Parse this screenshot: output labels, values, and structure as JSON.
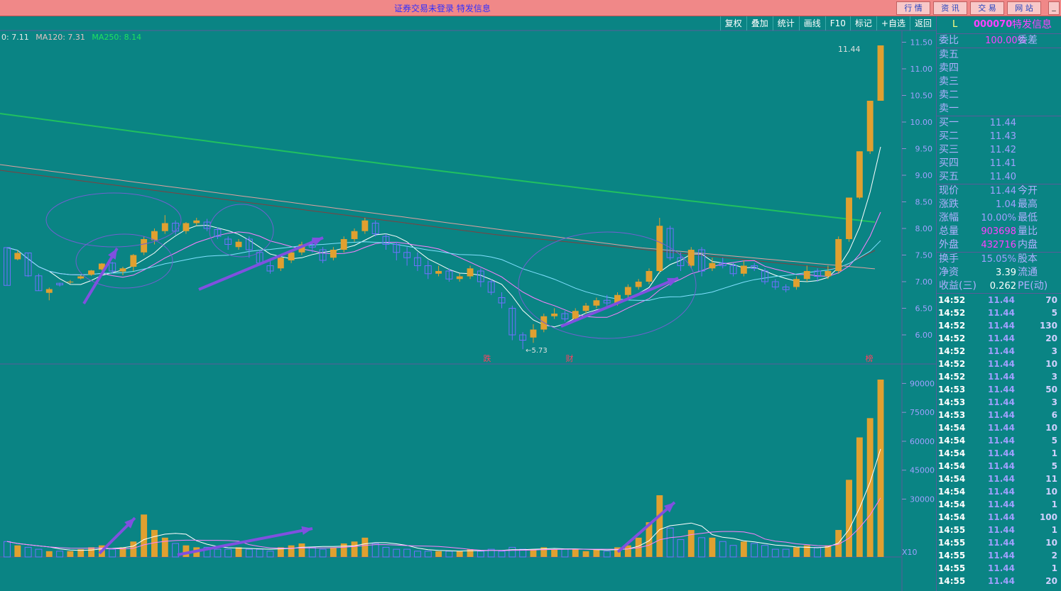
{
  "topbar": {
    "title": "证券交易未登录  特发信息",
    "buttons": [
      "行 情",
      "资 讯",
      "交 易",
      "网 站"
    ],
    "min_glyph": "_"
  },
  "toolbar": [
    "复权",
    "叠加",
    "统计",
    "画线",
    "F10",
    "标记",
    "+自选",
    "返回"
  ],
  "ma_legend": {
    "ma60": "0: 7.11",
    "ma120": "MA120: 7.31",
    "ma250": "MA250: 8.14"
  },
  "price_axis": [
    "11.50",
    "11.00",
    "10.50",
    "10.00",
    "9.50",
    "9.00",
    "8.50",
    "8.00",
    "7.50",
    "7.00",
    "6.50",
    "6.00"
  ],
  "volume_axis": [
    "90000",
    "75000",
    "60000",
    "45000",
    "30000"
  ],
  "volume_scale_label": "X10",
  "annotations": {
    "low": "5.73",
    "high": "11.44",
    "markers": [
      "跌",
      "财",
      "榜"
    ]
  },
  "panel": {
    "l": "L",
    "code": "000070",
    "name": "特发信息",
    "weibi_label": "委比",
    "weibi_value": "100.00%",
    "weicha_label": "委差",
    "sell": [
      {
        "label": "卖五",
        "price": ""
      },
      {
        "label": "卖四",
        "price": ""
      },
      {
        "label": "卖三",
        "price": ""
      },
      {
        "label": "卖二",
        "price": ""
      },
      {
        "label": "卖一",
        "price": ""
      }
    ],
    "buy": [
      {
        "label": "买一",
        "price": "11.44"
      },
      {
        "label": "买二",
        "price": "11.43"
      },
      {
        "label": "买三",
        "price": "11.42"
      },
      {
        "label": "买四",
        "price": "11.41"
      },
      {
        "label": "买五",
        "price": "11.40"
      }
    ],
    "stats1": [
      {
        "k": "现价",
        "v": "11.44",
        "k2": "今开"
      },
      {
        "k": "涨跌",
        "v": "1.04",
        "k2": "最高"
      },
      {
        "k": "涨幅",
        "v": "10.00%",
        "k2": "最低"
      },
      {
        "k": "总量",
        "v": "903698",
        "k2": "量比"
      },
      {
        "k": "外盘",
        "v": "432716",
        "k2": "内盘"
      }
    ],
    "stats2": [
      {
        "k": "换手",
        "v": "15.05%",
        "k2": "股本"
      },
      {
        "k": "净资",
        "v": "3.39",
        "k2": "流通"
      },
      {
        "k": "收益(三)",
        "v": "0.262",
        "k2": "PE(动)"
      }
    ],
    "ticks": [
      {
        "t": "14:52",
        "p": "11.44",
        "q": "70"
      },
      {
        "t": "14:52",
        "p": "11.44",
        "q": "5"
      },
      {
        "t": "14:52",
        "p": "11.44",
        "q": "130"
      },
      {
        "t": "14:52",
        "p": "11.44",
        "q": "20"
      },
      {
        "t": "14:52",
        "p": "11.44",
        "q": "3"
      },
      {
        "t": "14:52",
        "p": "11.44",
        "q": "10"
      },
      {
        "t": "14:52",
        "p": "11.44",
        "q": "3"
      },
      {
        "t": "14:53",
        "p": "11.44",
        "q": "50"
      },
      {
        "t": "14:53",
        "p": "11.44",
        "q": "3"
      },
      {
        "t": "14:53",
        "p": "11.44",
        "q": "6"
      },
      {
        "t": "14:54",
        "p": "11.44",
        "q": "10"
      },
      {
        "t": "14:54",
        "p": "11.44",
        "q": "5"
      },
      {
        "t": "14:54",
        "p": "11.44",
        "q": "1"
      },
      {
        "t": "14:54",
        "p": "11.44",
        "q": "5"
      },
      {
        "t": "14:54",
        "p": "11.44",
        "q": "11"
      },
      {
        "t": "14:54",
        "p": "11.44",
        "q": "10"
      },
      {
        "t": "14:54",
        "p": "11.44",
        "q": "1"
      },
      {
        "t": "14:54",
        "p": "11.44",
        "q": "100"
      },
      {
        "t": "14:55",
        "p": "11.44",
        "q": "1"
      },
      {
        "t": "14:55",
        "p": "11.44",
        "q": "10"
      },
      {
        "t": "14:55",
        "p": "11.44",
        "q": "2"
      },
      {
        "t": "14:55",
        "p": "11.44",
        "q": "1"
      },
      {
        "t": "14:55",
        "p": "11.44",
        "q": "20"
      }
    ]
  },
  "colors": {
    "bg": "#0a8484",
    "up": "#e0a030",
    "down": "#7070ff",
    "ma5": "#ffffff",
    "ma10": "#ff80ff",
    "ma20": "#80e0ff",
    "ma60": "#804040",
    "ma120": "#e0a0a0",
    "ma250": "#20c060",
    "arrow": "#8050e0"
  },
  "candles": [
    [
      6.93,
      7.64,
      7.65,
      6.93,
      "down"
    ],
    [
      7.42,
      7.54,
      7.59,
      7.4,
      "up"
    ],
    [
      7.54,
      7.11,
      7.54,
      7.09,
      "down"
    ],
    [
      7.11,
      6.83,
      7.15,
      6.83,
      "down"
    ],
    [
      6.79,
      6.86,
      6.89,
      6.65,
      "up"
    ],
    [
      6.97,
      6.94,
      6.98,
      6.91,
      "down"
    ],
    [
      6.99,
      7.0,
      7.03,
      6.96,
      "up"
    ],
    [
      7.06,
      7.1,
      7.12,
      7.04,
      "up"
    ],
    [
      7.13,
      7.21,
      7.22,
      7.11,
      "up"
    ],
    [
      7.23,
      7.34,
      7.35,
      7.21,
      "up"
    ],
    [
      7.35,
      7.2,
      7.37,
      7.15,
      "down"
    ],
    [
      7.19,
      7.25,
      7.28,
      7.12,
      "up"
    ],
    [
      7.28,
      7.5,
      7.52,
      7.2,
      "up"
    ],
    [
      7.55,
      7.8,
      7.85,
      7.5,
      "up"
    ],
    [
      7.78,
      7.95,
      8.0,
      7.7,
      "up"
    ],
    [
      7.95,
      8.1,
      8.25,
      7.9,
      "up"
    ],
    [
      8.1,
      7.95,
      8.15,
      7.88,
      "down"
    ],
    [
      7.95,
      8.1,
      8.12,
      7.9,
      "up"
    ],
    [
      8.1,
      8.15,
      8.2,
      8.05,
      "up"
    ],
    [
      8.12,
      8.0,
      8.18,
      7.95,
      "down"
    ],
    [
      7.98,
      7.85,
      8.02,
      7.8,
      "down"
    ],
    [
      7.8,
      7.7,
      7.85,
      7.6,
      "down"
    ],
    [
      7.65,
      7.75,
      7.8,
      7.6,
      "up"
    ],
    [
      7.8,
      7.6,
      7.85,
      7.45,
      "down"
    ],
    [
      7.55,
      7.35,
      7.6,
      7.3,
      "down"
    ],
    [
      7.3,
      7.2,
      7.4,
      7.15,
      "down"
    ],
    [
      7.25,
      7.45,
      7.5,
      7.2,
      "up"
    ],
    [
      7.4,
      7.55,
      7.6,
      7.35,
      "up"
    ],
    [
      7.55,
      7.7,
      7.75,
      7.5,
      "up"
    ],
    [
      7.7,
      7.65,
      7.8,
      7.55,
      "down"
    ],
    [
      7.6,
      7.4,
      7.65,
      7.35,
      "down"
    ],
    [
      7.45,
      7.6,
      7.65,
      7.4,
      "up"
    ],
    [
      7.6,
      7.8,
      7.85,
      7.55,
      "up"
    ],
    [
      7.8,
      7.95,
      8.0,
      7.75,
      "up"
    ],
    [
      7.95,
      8.15,
      8.2,
      7.9,
      "up"
    ],
    [
      8.1,
      7.9,
      8.15,
      7.85,
      "down"
    ],
    [
      7.85,
      7.7,
      7.9,
      7.6,
      "down"
    ],
    [
      7.7,
      7.55,
      7.75,
      7.4,
      "down"
    ],
    [
      7.55,
      7.45,
      7.65,
      7.3,
      "down"
    ],
    [
      7.45,
      7.3,
      7.55,
      7.2,
      "down"
    ],
    [
      7.3,
      7.15,
      7.4,
      7.05,
      "down"
    ],
    [
      7.15,
      7.2,
      7.3,
      7.1,
      "up"
    ],
    [
      7.2,
      7.05,
      7.25,
      7.0,
      "down"
    ],
    [
      7.05,
      7.1,
      7.15,
      7.0,
      "up"
    ],
    [
      7.1,
      7.25,
      7.3,
      7.05,
      "up"
    ],
    [
      7.2,
      7.0,
      7.25,
      6.9,
      "down"
    ],
    [
      7.0,
      6.8,
      7.05,
      6.75,
      "down"
    ],
    [
      6.7,
      6.6,
      6.8,
      6.5,
      "down"
    ],
    [
      6.5,
      6.0,
      6.55,
      5.9,
      "down"
    ],
    [
      6.0,
      5.9,
      6.05,
      5.73,
      "down"
    ],
    [
      5.95,
      6.1,
      6.2,
      5.85,
      "up"
    ],
    [
      6.1,
      6.35,
      6.4,
      6.05,
      "up"
    ],
    [
      6.35,
      6.4,
      6.5,
      6.3,
      "up"
    ],
    [
      6.4,
      6.3,
      6.45,
      6.25,
      "down"
    ],
    [
      6.3,
      6.45,
      6.5,
      6.25,
      "up"
    ],
    [
      6.45,
      6.55,
      6.6,
      6.4,
      "up"
    ],
    [
      6.55,
      6.65,
      6.7,
      6.5,
      "up"
    ],
    [
      6.65,
      6.6,
      6.75,
      6.55,
      "down"
    ],
    [
      6.6,
      6.75,
      6.8,
      6.55,
      "up"
    ],
    [
      6.75,
      6.9,
      6.95,
      6.7,
      "up"
    ],
    [
      6.9,
      7.0,
      7.05,
      6.85,
      "up"
    ],
    [
      7.0,
      7.2,
      7.25,
      6.95,
      "up"
    ],
    [
      7.2,
      8.05,
      8.2,
      7.15,
      "up"
    ],
    [
      8.0,
      7.45,
      8.05,
      7.4,
      "down"
    ],
    [
      7.45,
      7.3,
      7.55,
      7.2,
      "down"
    ],
    [
      7.3,
      7.6,
      7.65,
      7.25,
      "up"
    ],
    [
      7.6,
      7.2,
      7.65,
      7.1,
      "down"
    ],
    [
      7.25,
      7.35,
      7.45,
      7.2,
      "up"
    ],
    [
      7.35,
      7.3,
      7.45,
      7.25,
      "down"
    ],
    [
      7.3,
      7.15,
      7.35,
      7.1,
      "down"
    ],
    [
      7.15,
      7.3,
      7.4,
      7.1,
      "up"
    ],
    [
      7.3,
      7.25,
      7.35,
      7.2,
      "down"
    ],
    [
      7.2,
      7.0,
      7.25,
      6.95,
      "down"
    ],
    [
      7.0,
      6.9,
      7.05,
      6.85,
      "down"
    ],
    [
      6.9,
      6.85,
      6.95,
      6.8,
      "down"
    ],
    [
      6.9,
      7.05,
      7.1,
      6.85,
      "up"
    ],
    [
      7.05,
      7.2,
      7.3,
      7.0,
      "up"
    ],
    [
      7.2,
      7.1,
      7.25,
      7.0,
      "down"
    ],
    [
      7.1,
      7.2,
      7.3,
      7.05,
      "up"
    ],
    [
      7.2,
      7.8,
      7.85,
      7.15,
      "up"
    ],
    [
      7.8,
      8.58,
      8.58,
      7.75,
      "up"
    ],
    [
      8.58,
      9.45,
      9.45,
      8.55,
      "up"
    ],
    [
      9.45,
      10.4,
      10.4,
      9.4,
      "up"
    ],
    [
      10.4,
      11.44,
      11.44,
      10.4,
      "up"
    ]
  ],
  "volumes": [
    8,
    6,
    5,
    4,
    3,
    3,
    3,
    4,
    5,
    6,
    4,
    5,
    8,
    22,
    14,
    10,
    7,
    6,
    5,
    5,
    4,
    4,
    5,
    4,
    4,
    3,
    5,
    6,
    7,
    5,
    4,
    5,
    7,
    8,
    10,
    7,
    5,
    4,
    4,
    3,
    3,
    3,
    3,
    3,
    4,
    3,
    4,
    3,
    5,
    4,
    4,
    5,
    4,
    4,
    4,
    3,
    4,
    3,
    5,
    6,
    10,
    18,
    32,
    15,
    9,
    14,
    10,
    10,
    8,
    6,
    8,
    7,
    6,
    4,
    4,
    5,
    6,
    5,
    6,
    14,
    40,
    62,
    72,
    92
  ]
}
